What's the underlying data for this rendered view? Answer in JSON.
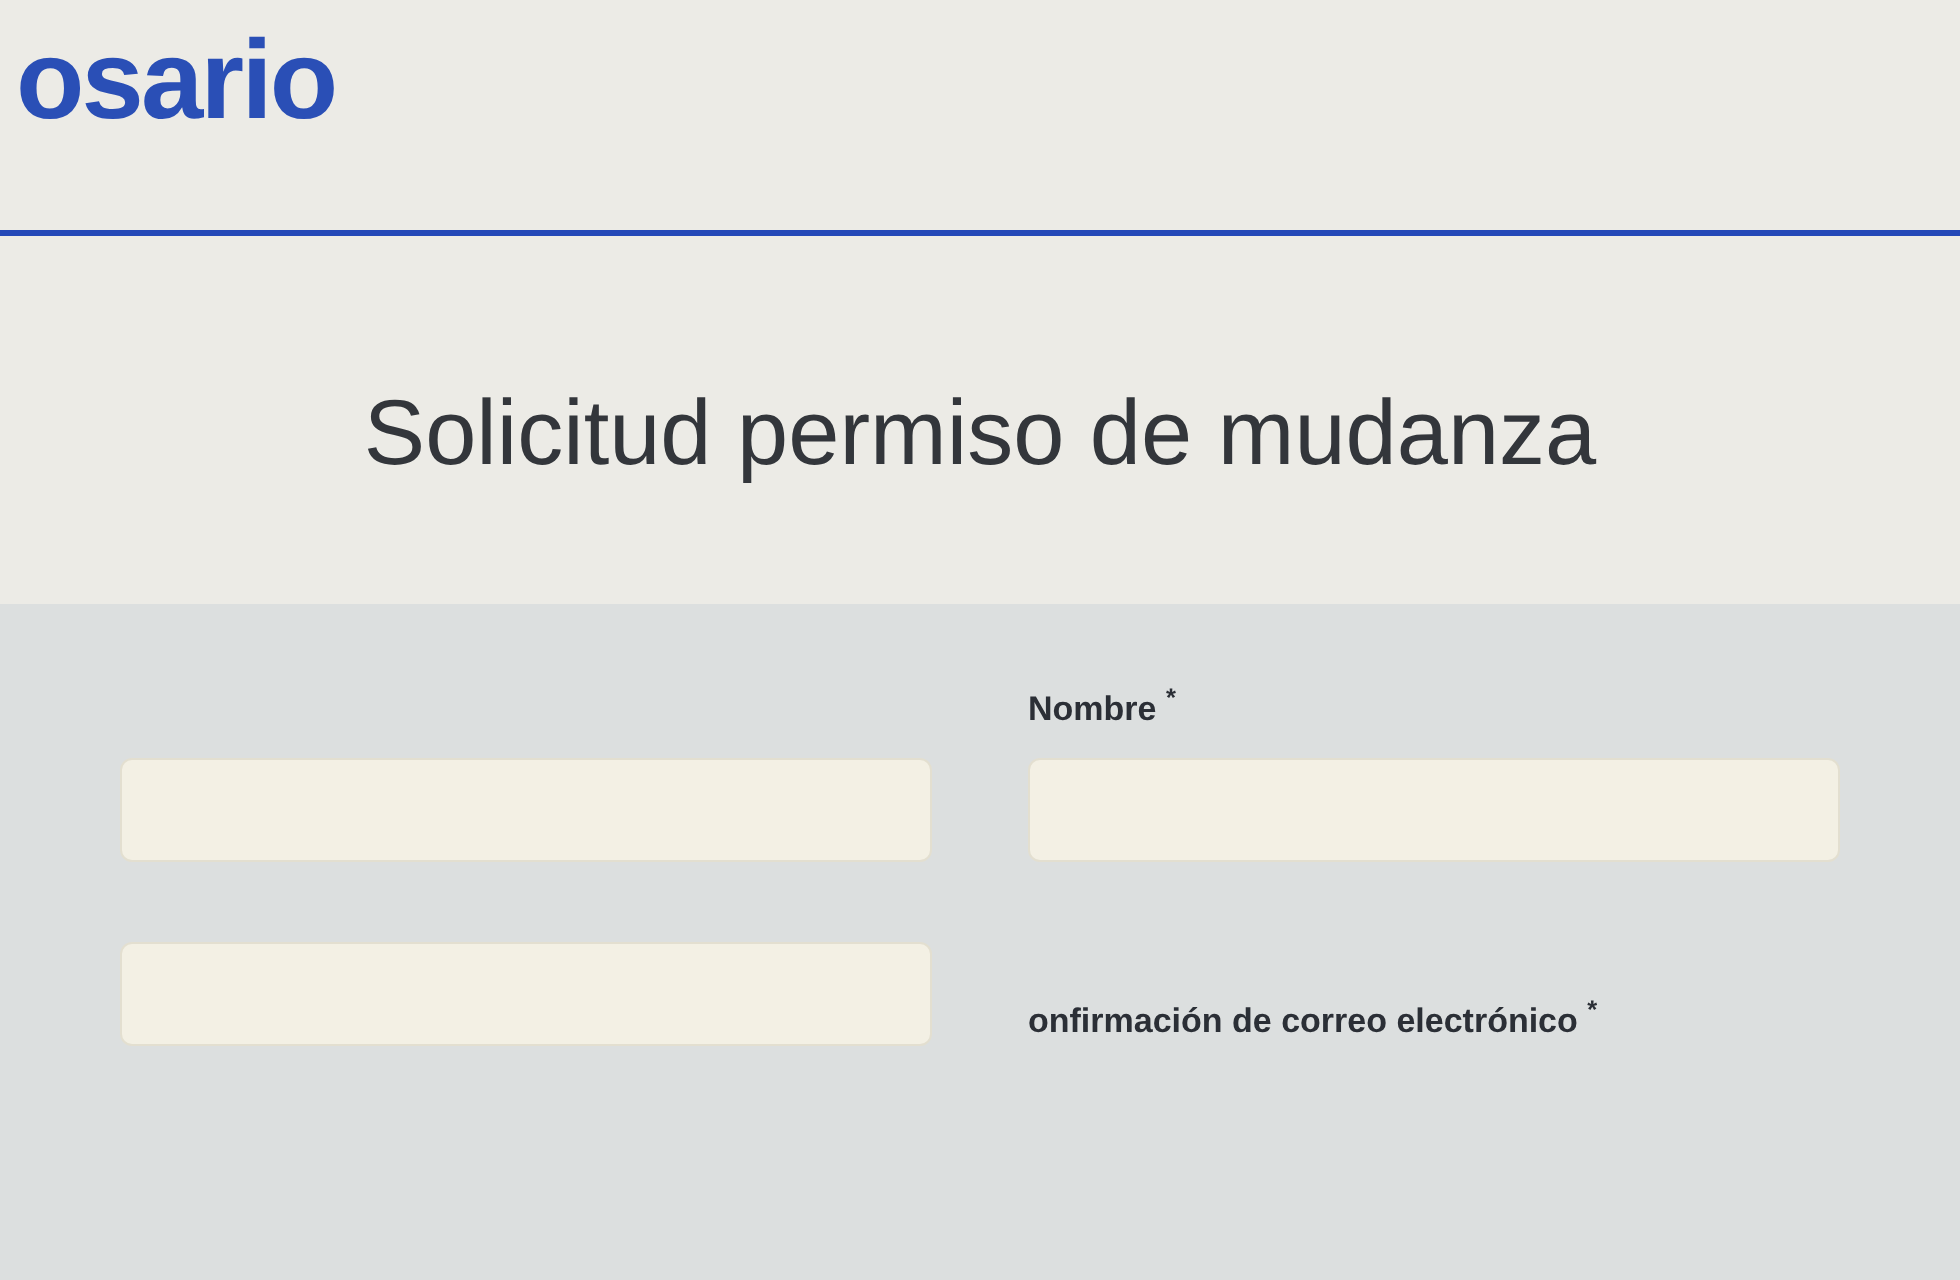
{
  "header": {
    "logo": "osario"
  },
  "title": "Solicitud permiso de mudanza",
  "form": {
    "rows": [
      {
        "fields": [
          {
            "kind": "input"
          },
          {
            "kind": "input",
            "label": "Nombre $^{*}$"
          }
        ]
      },
      {
        "fields": [
          {
            "kind": "input"
          },
          {
            "kind": "label",
            "label": "onfirmación de correo electrónico $^{*}$"
          }
        ]
      }
    ]
  }
}
